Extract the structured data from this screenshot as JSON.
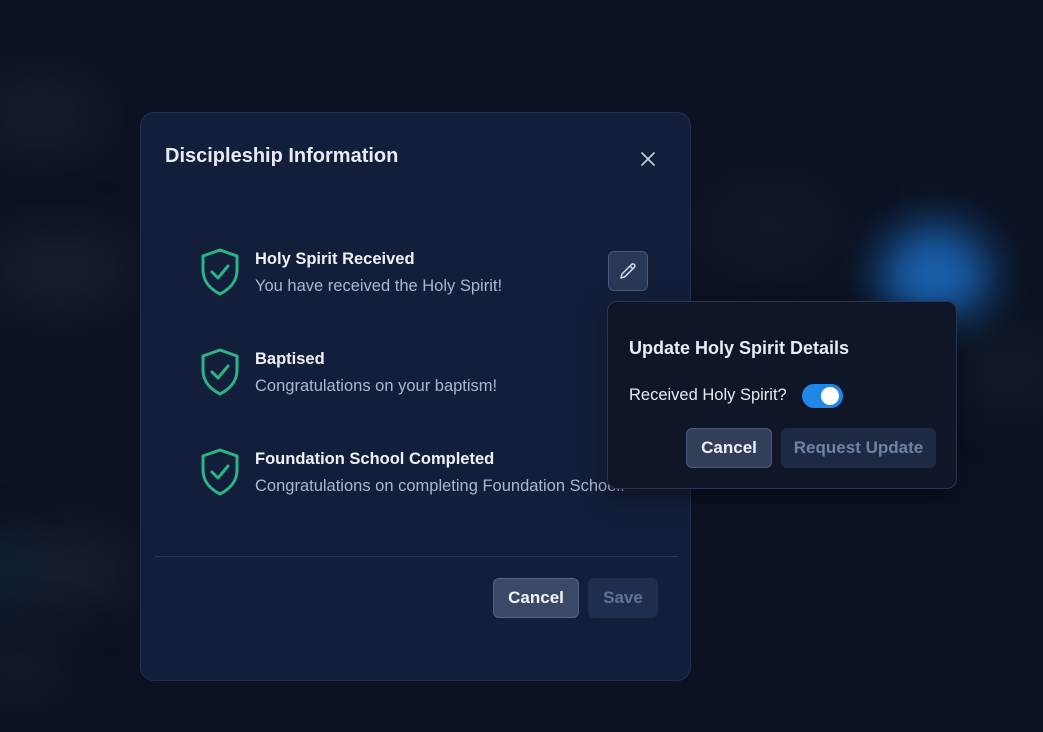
{
  "modal": {
    "title": "Discipleship Information",
    "items": [
      {
        "title": "Holy Spirit Received",
        "description": "You have received the Holy Spirit!"
      },
      {
        "title": "Baptised",
        "description": "Congratulations on your baptism!"
      },
      {
        "title": "Foundation School Completed",
        "description": "Congratulations on completing Foundation School!"
      }
    ],
    "cancel_label": "Cancel",
    "save_label": "Save"
  },
  "popover": {
    "title": "Update Holy Spirit Details",
    "toggle_label": "Received Holy Spirit?",
    "toggle_on": true,
    "cancel_label": "Cancel",
    "request_label": "Request Update"
  },
  "colors": {
    "accent": "#2187e7",
    "success": "#2bb584",
    "panel": "#131f3a"
  },
  "icons": {
    "close": "close-icon",
    "status": "shield-check-icon",
    "edit": "pencil-icon"
  }
}
